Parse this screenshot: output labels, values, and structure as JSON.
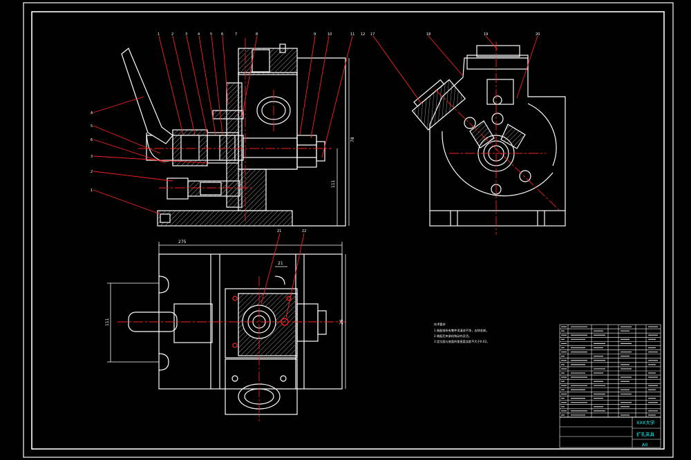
{
  "colors": {
    "background": "#000000",
    "frame": "#ffffff",
    "leader": "#ff2020",
    "centerline": "#ff2020",
    "hatch": "#9a9a9a",
    "dimension": "#ffffff",
    "bom_text": "#ffffff",
    "title_accent": "#00ffff"
  },
  "balloons": {
    "front_top": [
      "1",
      "2",
      "3",
      "4",
      "5",
      "6",
      "7",
      "8",
      "9",
      "10",
      "11",
      "12"
    ],
    "front_left": [
      "A",
      "5",
      "6",
      "3",
      "2",
      "1"
    ],
    "side_top": [
      "17",
      "18",
      "19",
      "20"
    ],
    "top_view": [
      "21",
      "22"
    ]
  },
  "dimensions": {
    "overall_height": "78",
    "center_height": "111",
    "plan_width": "275",
    "plan_depth": "26",
    "clamp_span": "111",
    "slot": "21"
  },
  "notes": {
    "heading": "技术要求",
    "lines": [
      "1.装配前所有零件须清洗干净，去除毛刺。",
      "2.装配后夹紧机构动作灵活。",
      "3.定位面与底面的垂直度误差不大于0.02。"
    ]
  },
  "title_block": {
    "school": "XXX大学",
    "drawing_name": "扩孔夹具",
    "sheet_size": "A0"
  },
  "icons": [
    "handle-lever-icon",
    "hex-nut-icon",
    "bushing-icon",
    "clamp-bolt-icon"
  ]
}
